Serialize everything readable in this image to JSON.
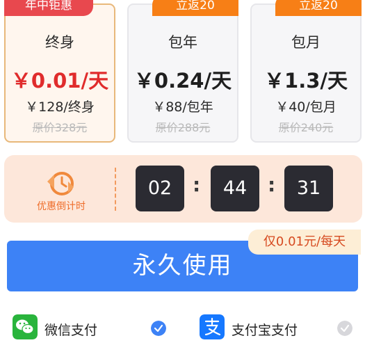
{
  "plans": [
    {
      "badge": "年中钜惠",
      "name": "终身",
      "daily": "￥0.01/天",
      "price": "￥128/终身",
      "original": "原价328元",
      "selected": true
    },
    {
      "badge": "立返20",
      "name": "包年",
      "daily": "￥0.24/天",
      "price": "￥88/包年",
      "original": "原价288元",
      "selected": false
    },
    {
      "badge": "立返20",
      "name": "包月",
      "daily": "￥1.3/天",
      "price": "￥40/包月",
      "original": "原价240元",
      "selected": false
    }
  ],
  "countdown": {
    "label": "优惠倒计时",
    "hours": "02",
    "minutes": "44",
    "seconds": "31",
    "separator": ":"
  },
  "cta": {
    "label": "永久使用",
    "tag": "仅0.01元/每天"
  },
  "payment": {
    "wechat": {
      "label": "微信支付",
      "selected": true
    },
    "alipay": {
      "label": "支付宝支付",
      "selected": false
    }
  },
  "colors": {
    "accent_red": "#e02c2c",
    "accent_orange": "#f77f16",
    "cta_blue": "#3d82f6",
    "wechat_green": "#29b43c",
    "alipay_blue": "#1678ff"
  }
}
